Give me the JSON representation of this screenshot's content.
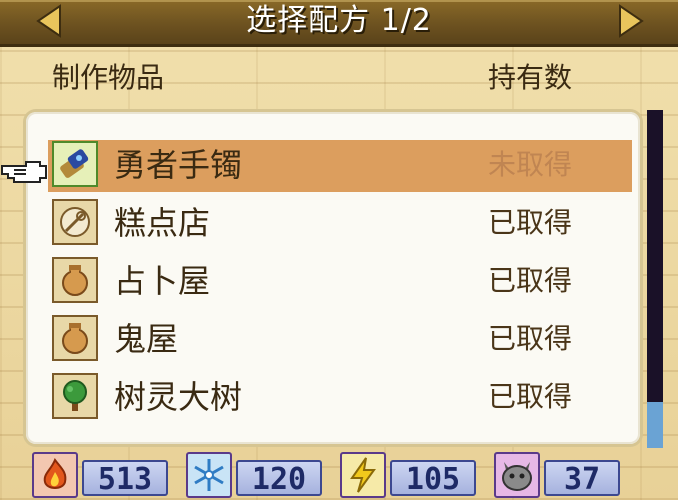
{
  "header": {
    "title": "选择配方 1/2"
  },
  "columns": {
    "item": "制作物品",
    "count": "持有数"
  },
  "rows": [
    {
      "name": "勇者手镯",
      "status": "未取得",
      "icon": "bracelet-icon",
      "selected": true
    },
    {
      "name": "糕点店",
      "status": "已取得",
      "icon": "cake-shop-icon",
      "selected": false
    },
    {
      "name": "占卜屋",
      "status": "已取得",
      "icon": "vase-icon",
      "selected": false
    },
    {
      "name": "鬼屋",
      "status": "已取得",
      "icon": "vase-icon",
      "selected": false
    },
    {
      "name": "树灵大树",
      "status": "已取得",
      "icon": "tree-icon",
      "selected": false
    }
  ],
  "resources": [
    {
      "icon": "fire-icon",
      "value": "513"
    },
    {
      "icon": "snowflake-icon",
      "value": "120"
    },
    {
      "icon": "lightning-icon",
      "value": "105"
    },
    {
      "icon": "monster-icon",
      "value": "37"
    }
  ],
  "colors": {
    "selected_row": "#dc9e5e",
    "header_bar": "#6d5220",
    "panel": "#fbfaf4",
    "scroll_thumb": "#6aa3d4"
  }
}
